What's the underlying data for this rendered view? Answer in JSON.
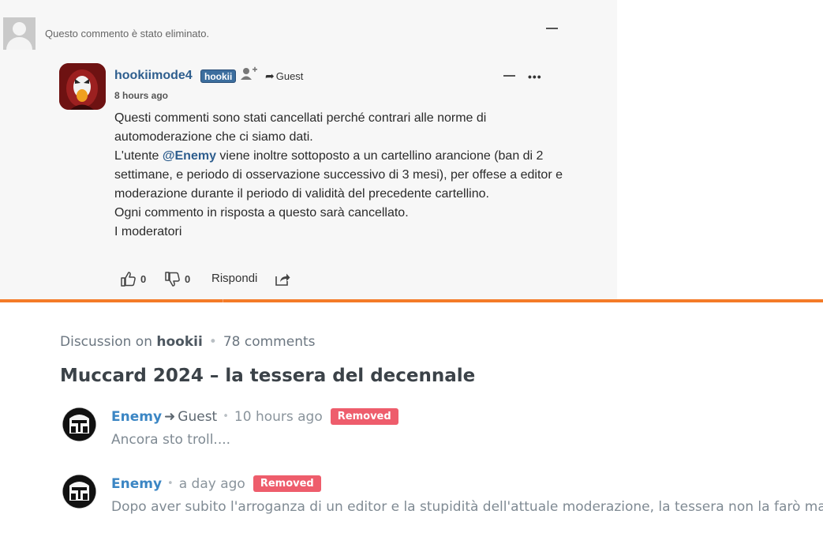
{
  "deleted_comment": {
    "text": "Questo commento è stato eliminato."
  },
  "reply": {
    "author": "hookiimode4",
    "badge": "hookii",
    "via": "Guest",
    "time": "8 hours ago",
    "body_line_1": "Questi commenti sono stati cancellati perché contrari alle norme di automoderazione che ci siamo dati.",
    "body_prefix": "L'utente ",
    "mention": "@Enemy",
    "body_suffix": " viene inoltre sottoposto a un cartellino arancione (ban di 2 settimane, e periodo di osservazione successivo di 3 mesi), per offese a editor e moderazione durante il periodo di validità del precedente cartellino.",
    "body_line_3": "Ogni commento in risposta a questo sarà cancellato.",
    "body_line_4": "I moderatori",
    "upvotes": "0",
    "downvotes": "0",
    "reply_label": "Rispondi"
  },
  "discussion": {
    "prefix": "Discussion on",
    "site": "hookii",
    "comments": "78 comments",
    "title": "Muccard 2024 – la tessera del decennale"
  },
  "activity": [
    {
      "name": "Enemy",
      "via": "Guest",
      "time": "10 hours ago",
      "badge": "Removed",
      "text": "Ancora sto troll...."
    },
    {
      "name": "Enemy",
      "time": "a day ago",
      "badge": "Removed",
      "text": "Dopo aver subito l'arroganza di un editor e la stupidità dell'attuale moderazione, la tessera non la farò ma"
    }
  ],
  "colors": {
    "accent_orange": "#f47b28",
    "link_blue": "#2e5e8e",
    "removed_red": "#ee5d6c"
  }
}
